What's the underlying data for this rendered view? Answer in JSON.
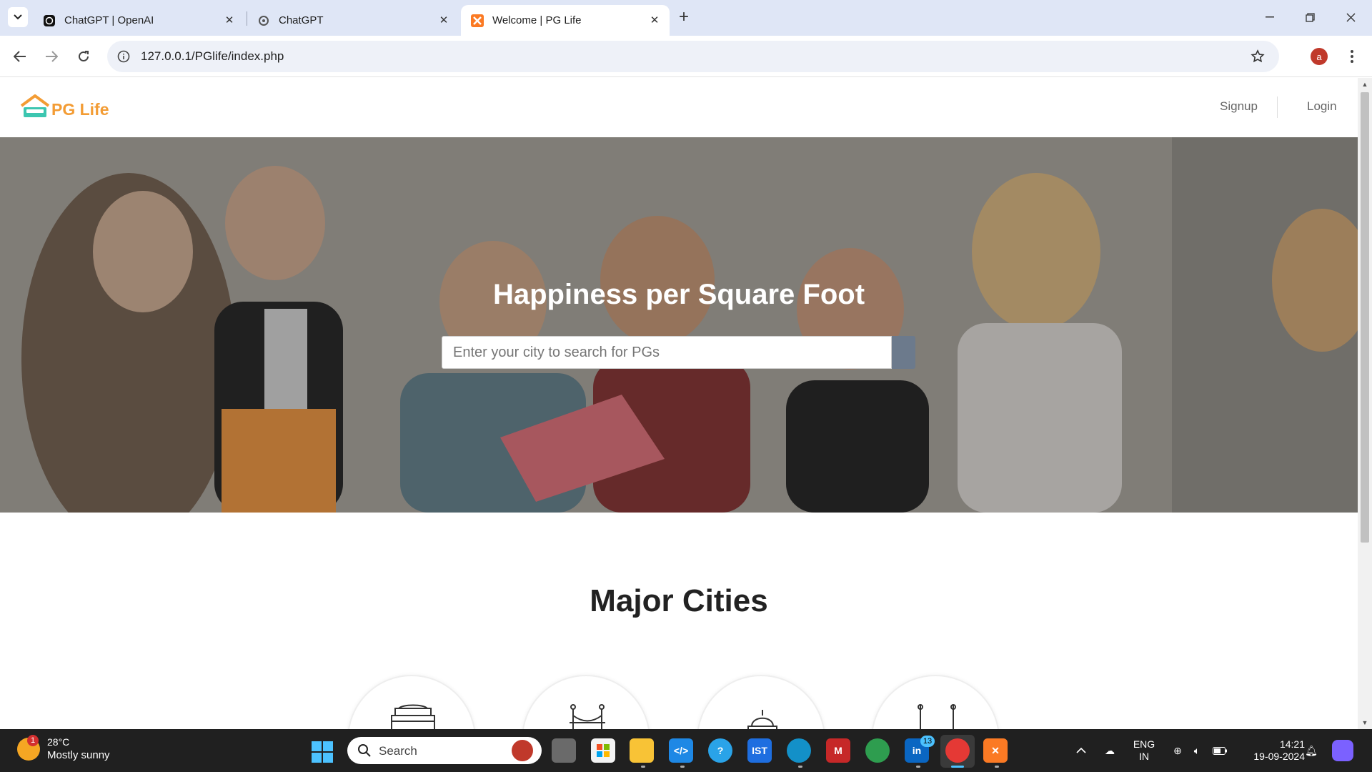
{
  "browser": {
    "tabs": [
      {
        "title": "ChatGPT | OpenAI",
        "favicon": "openai-icon",
        "active": false
      },
      {
        "title": "ChatGPT",
        "favicon": "openai-icon",
        "active": false
      },
      {
        "title": "Welcome | PG Life",
        "favicon": "xampp-icon",
        "active": true
      }
    ],
    "url": "127.0.0.1/PGlife/index.php",
    "profile_initial": "a"
  },
  "site": {
    "logo_text": "PG Life",
    "nav": {
      "signup": "Signup",
      "login": "Login"
    },
    "hero": {
      "title": "Happiness per Square Foot",
      "search_placeholder": "Enter your city to search for PGs"
    },
    "cities_title": "Major Cities",
    "city_icons": [
      "india-gate-icon",
      "bridge-icon",
      "monument-dome-icon",
      "charminar-icon"
    ]
  },
  "taskbar": {
    "weather": {
      "temp": "28°C",
      "condition": "Mostly sunny",
      "badge": "1"
    },
    "search_label": "Search",
    "linkedin_badge": "13",
    "lang": {
      "line1": "ENG",
      "line2": "IN"
    },
    "time": "14:21",
    "date": "19-09-2024"
  },
  "colors": {
    "brand_orange": "#f39c34",
    "brand_teal": "#3cc6b0",
    "taskbar_bg": "#202020"
  }
}
